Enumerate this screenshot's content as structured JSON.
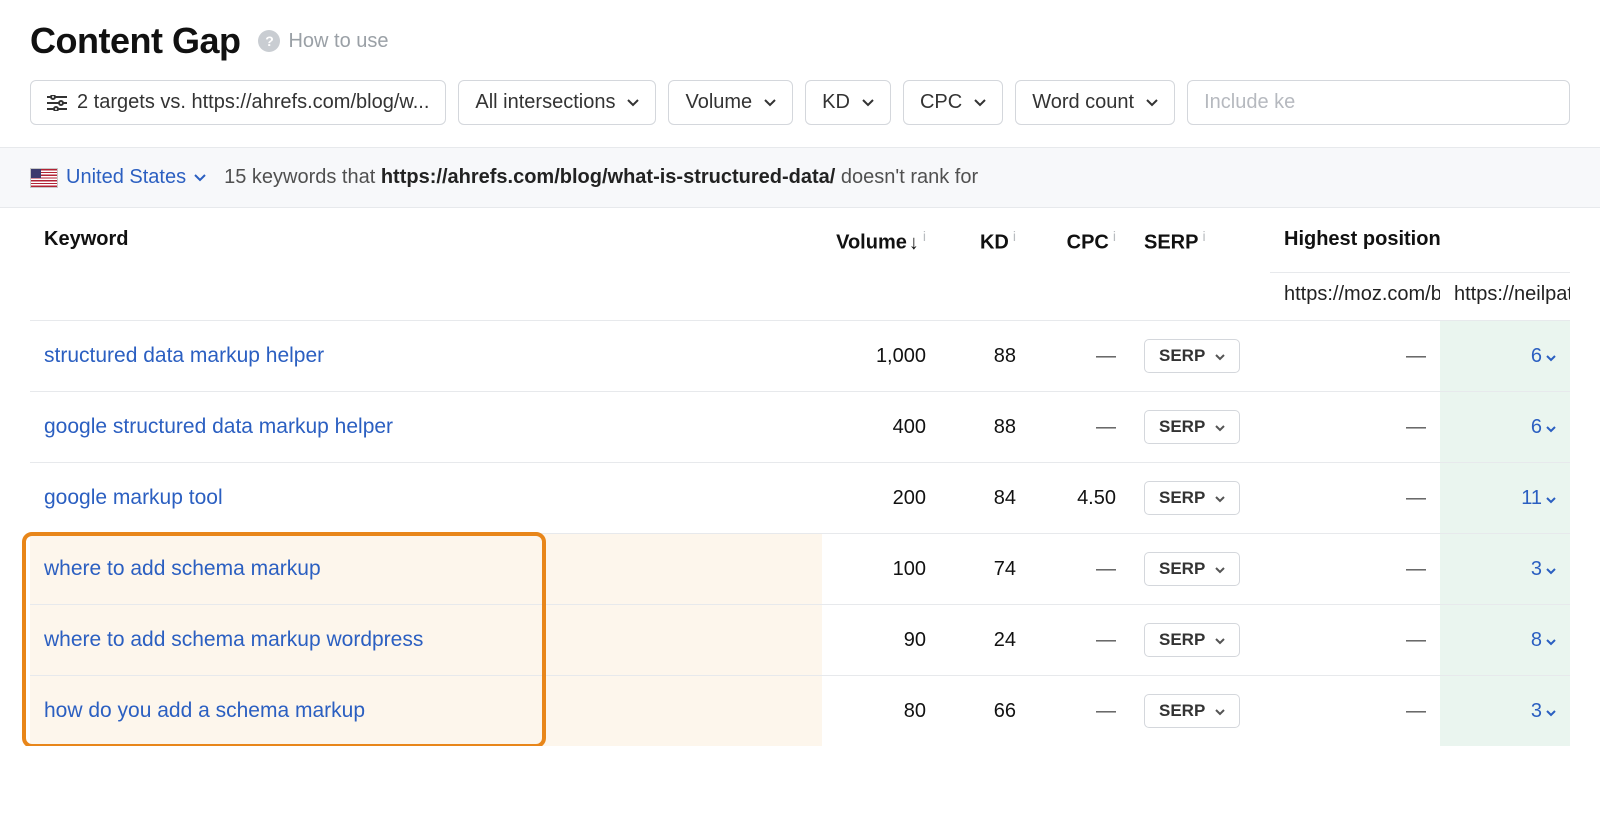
{
  "header": {
    "title": "Content Gap",
    "how_to_use": "How to use"
  },
  "filters": {
    "targets": "2 targets vs. https://ahrefs.com/blog/w...",
    "intersections": "All intersections",
    "volume": "Volume",
    "kd": "KD",
    "cpc": "CPC",
    "word_count": "Word count",
    "include_placeholder": "Include ke"
  },
  "summary": {
    "country": "United States",
    "count": "15",
    "mid_text": "keywords that",
    "url": "https://ahrefs.com/blog/what-is-structured-data/",
    "tail": "doesn't rank for"
  },
  "columns": {
    "keyword": "Keyword",
    "volume": "Volume",
    "kd": "KD",
    "cpc": "CPC",
    "serp": "SERP",
    "highest": "Highest position",
    "comp_a": "https://moz.com/blo",
    "comp_b": "https://neilpat"
  },
  "serp_button": "SERP",
  "rows": [
    {
      "keyword": "structured data markup helper",
      "volume": "1,000",
      "kd": "88",
      "cpc": "—",
      "pos_a": "—",
      "pos_b": "6",
      "hl": false
    },
    {
      "keyword": "google structured data markup helper",
      "volume": "400",
      "kd": "88",
      "cpc": "—",
      "pos_a": "—",
      "pos_b": "6",
      "hl": false
    },
    {
      "keyword": "google markup tool",
      "volume": "200",
      "kd": "84",
      "cpc": "4.50",
      "pos_a": "—",
      "pos_b": "11",
      "hl": false
    },
    {
      "keyword": "where to add schema markup",
      "volume": "100",
      "kd": "74",
      "cpc": "—",
      "pos_a": "—",
      "pos_b": "3",
      "hl": true
    },
    {
      "keyword": "where to add schema markup wordpress",
      "volume": "90",
      "kd": "24",
      "cpc": "—",
      "pos_a": "—",
      "pos_b": "8",
      "hl": true
    },
    {
      "keyword": "how do you add a schema markup",
      "volume": "80",
      "kd": "66",
      "cpc": "—",
      "pos_a": "—",
      "pos_b": "3",
      "hl": true
    }
  ]
}
